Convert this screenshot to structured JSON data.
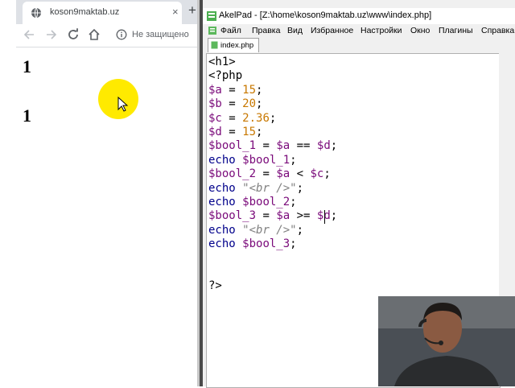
{
  "browser": {
    "tab_title": "koson9maktab.uz",
    "tab_close": "×",
    "new_tab": "+",
    "omnibox_security": "Не защищено",
    "output": [
      "1",
      "1"
    ]
  },
  "akelpad": {
    "window_title": "AkelPad - [Z:\\home\\koson9maktab.uz\\www\\index.php]",
    "menu": [
      "Файл",
      "Правка",
      "Вид",
      "Избранное",
      "Настройки",
      "Окно",
      "Плагины",
      "Справка"
    ],
    "file_tab": "index.php",
    "code": [
      [
        {
          "t": "<h1>",
          "c": "t"
        }
      ],
      [
        {
          "t": "<?php",
          "c": "t"
        }
      ],
      [
        {
          "t": "$a",
          "c": "v"
        },
        {
          "t": " = ",
          "c": "o"
        },
        {
          "t": "15",
          "c": "n"
        },
        {
          "t": ";",
          "c": "o"
        }
      ],
      [
        {
          "t": "$b",
          "c": "v"
        },
        {
          "t": " = ",
          "c": "o"
        },
        {
          "t": "20",
          "c": "n"
        },
        {
          "t": ";",
          "c": "o"
        }
      ],
      [
        {
          "t": "$c",
          "c": "v"
        },
        {
          "t": " = ",
          "c": "o"
        },
        {
          "t": "2.36",
          "c": "n"
        },
        {
          "t": ";",
          "c": "o"
        }
      ],
      [
        {
          "t": "$d",
          "c": "v"
        },
        {
          "t": " = ",
          "c": "o"
        },
        {
          "t": "15",
          "c": "n"
        },
        {
          "t": ";",
          "c": "o"
        }
      ],
      [
        {
          "t": "$bool_1",
          "c": "v"
        },
        {
          "t": " = ",
          "c": "o"
        },
        {
          "t": "$a",
          "c": "v"
        },
        {
          "t": " == ",
          "c": "o"
        },
        {
          "t": "$d",
          "c": "v"
        },
        {
          "t": ";",
          "c": "o"
        }
      ],
      [
        {
          "t": "echo",
          "c": "k"
        },
        {
          "t": " ",
          "c": "o"
        },
        {
          "t": "$bool_1",
          "c": "v"
        },
        {
          "t": ";",
          "c": "o"
        }
      ],
      [
        {
          "t": "$bool_2",
          "c": "v"
        },
        {
          "t": " = ",
          "c": "o"
        },
        {
          "t": "$a",
          "c": "v"
        },
        {
          "t": " < ",
          "c": "o"
        },
        {
          "t": "$c",
          "c": "v"
        },
        {
          "t": ";",
          "c": "o"
        }
      ],
      [
        {
          "t": "echo",
          "c": "k"
        },
        {
          "t": " ",
          "c": "o"
        },
        {
          "t": "\"<br />\"",
          "c": "s"
        },
        {
          "t": ";",
          "c": "o"
        }
      ],
      [
        {
          "t": "echo",
          "c": "k"
        },
        {
          "t": " ",
          "c": "o"
        },
        {
          "t": "$bool_2",
          "c": "v"
        },
        {
          "t": ";",
          "c": "o"
        }
      ],
      [
        {
          "t": "$bool_3",
          "c": "v"
        },
        {
          "t": " = ",
          "c": "o"
        },
        {
          "t": "$a",
          "c": "v"
        },
        {
          "t": " >= ",
          "c": "o"
        },
        {
          "t": "$d",
          "c": "v"
        },
        {
          "t": ";",
          "c": "o"
        }
      ],
      [
        {
          "t": "echo",
          "c": "k"
        },
        {
          "t": " ",
          "c": "o"
        },
        {
          "t": "\"<br />\"",
          "c": "s"
        },
        {
          "t": ";",
          "c": "o"
        }
      ],
      [
        {
          "t": "echo",
          "c": "k"
        },
        {
          "t": " ",
          "c": "o"
        },
        {
          "t": "$bool_3",
          "c": "v"
        },
        {
          "t": ";",
          "c": "o"
        }
      ],
      [],
      [],
      [
        {
          "t": "?>",
          "c": "t"
        }
      ]
    ]
  },
  "colors": {
    "variable": "#7a0a7a",
    "number": "#c87800",
    "keyword": "#00008b",
    "string": "#808080",
    "cursor_highlight": "#ffea00"
  },
  "icons": {
    "tab_favicon": "globe-icon",
    "back": "arrow-left-icon",
    "forward": "arrow-right-icon",
    "reload": "reload-icon",
    "home": "home-icon",
    "site_info": "info-icon",
    "app": "akelpad-icon"
  }
}
